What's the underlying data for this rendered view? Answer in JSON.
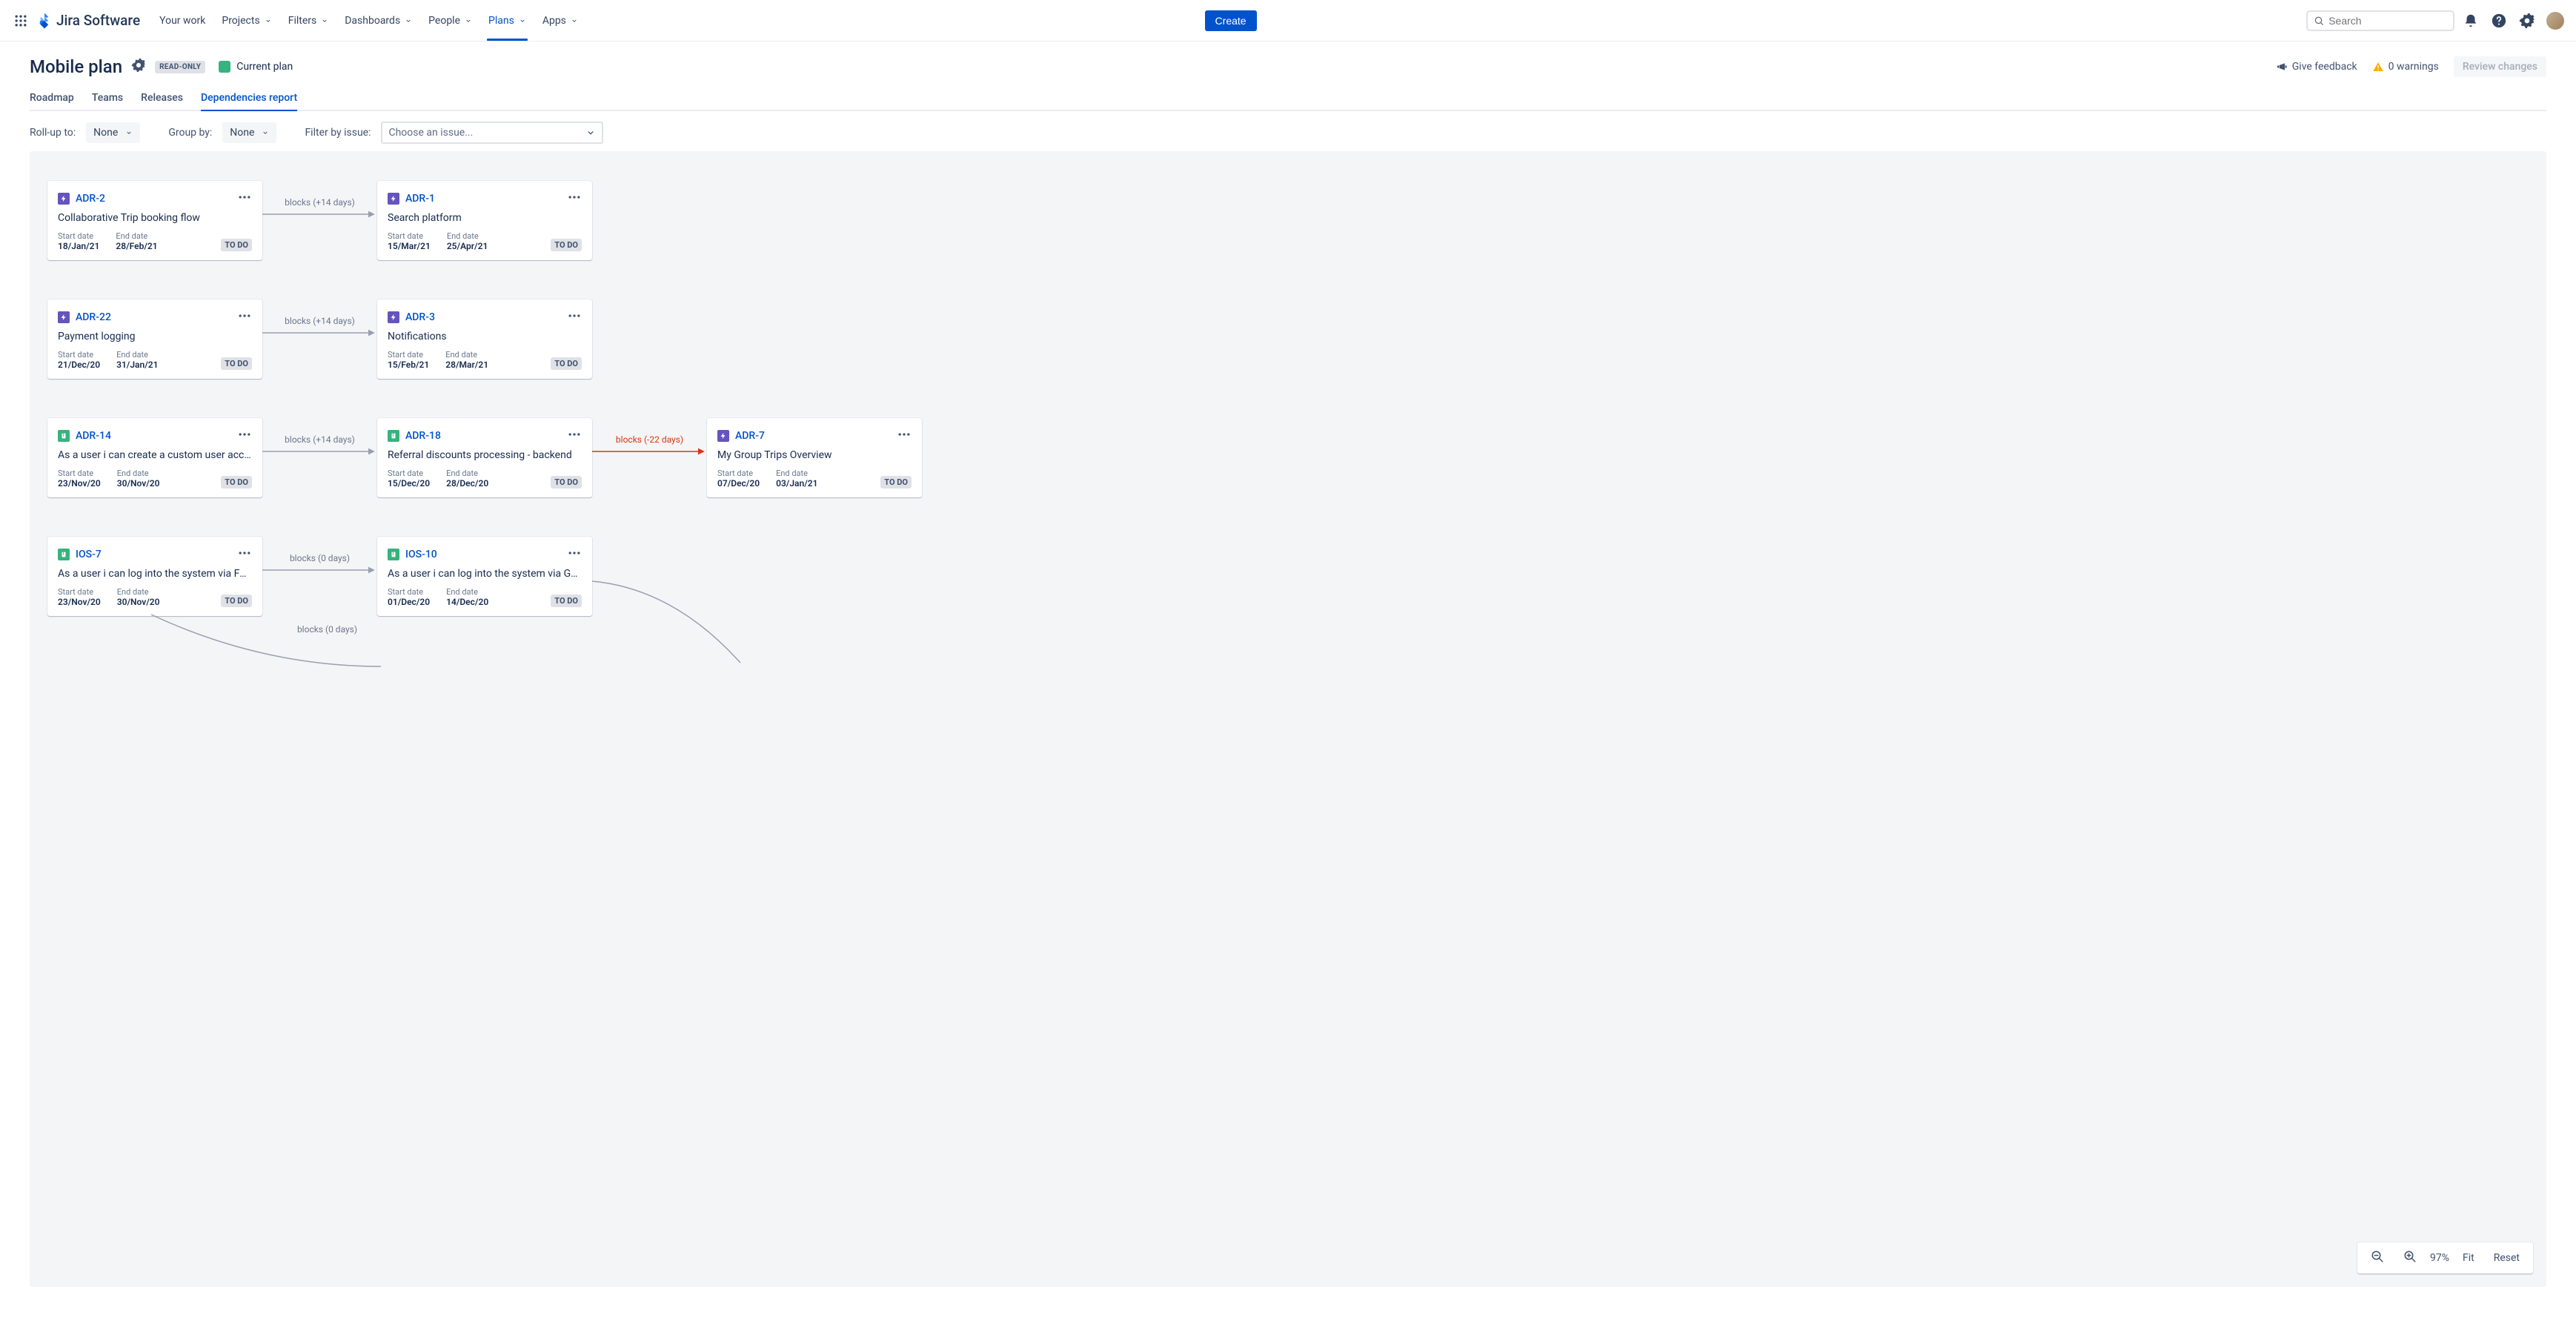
{
  "nav": {
    "logo_text": "Jira Software",
    "items": [
      "Your work",
      "Projects",
      "Filters",
      "Dashboards",
      "People",
      "Plans",
      "Apps"
    ],
    "active_index": 5,
    "create": "Create",
    "search_placeholder": "Search"
  },
  "header": {
    "title": "Mobile plan",
    "readonly_badge": "READ-ONLY",
    "current_plan": "Current plan",
    "give_feedback": "Give feedback",
    "warnings": "0 warnings",
    "review": "Review changes"
  },
  "tabs": {
    "items": [
      "Roadmap",
      "Teams",
      "Releases",
      "Dependencies report"
    ],
    "active_index": 3
  },
  "toolbar": {
    "rollup_label": "Roll-up to:",
    "rollup_value": "None",
    "groupby_label": "Group by:",
    "groupby_value": "None",
    "filter_label": "Filter by issue:",
    "filter_placeholder": "Choose an issue..."
  },
  "labels": {
    "start": "Start date",
    "end": "End date"
  },
  "rows": [
    {
      "conn1": "blocks (+14 days)",
      "cards": [
        {
          "type": "epic",
          "key": "ADR-2",
          "title": "Collaborative Trip booking flow",
          "start": "18/Jan/21",
          "end": "28/Feb/21",
          "status": "TO DO"
        },
        {
          "type": "epic",
          "key": "ADR-1",
          "title": "Search platform",
          "start": "15/Mar/21",
          "end": "25/Apr/21",
          "status": "TO DO"
        }
      ]
    },
    {
      "conn1": "blocks (+14 days)",
      "cards": [
        {
          "type": "epic",
          "key": "ADR-22",
          "title": "Payment logging",
          "start": "21/Dec/20",
          "end": "31/Jan/21",
          "status": "TO DO"
        },
        {
          "type": "epic",
          "key": "ADR-3",
          "title": "Notifications",
          "start": "15/Feb/21",
          "end": "28/Mar/21",
          "status": "TO DO"
        }
      ]
    },
    {
      "conn1": "blocks (+14 days)",
      "conn2": "blocks (-22 days)",
      "cards": [
        {
          "type": "story",
          "key": "ADR-14",
          "title": "As a user i can create a custom user acc…",
          "start": "23/Nov/20",
          "end": "30/Nov/20",
          "status": "TO DO"
        },
        {
          "type": "story",
          "key": "ADR-18",
          "title": "Referral discounts processing - backend",
          "start": "15/Dec/20",
          "end": "28/Dec/20",
          "status": "TO DO"
        },
        {
          "type": "epic",
          "key": "ADR-7",
          "title": "My Group Trips Overview",
          "start": "07/Dec/20",
          "end": "03/Jan/21",
          "status": "TO DO"
        }
      ]
    },
    {
      "conn1": "blocks (0 days)",
      "conn_below": "blocks (0 days)",
      "cards": [
        {
          "type": "story",
          "key": "IOS-7",
          "title": "As a user i can log into the system via Fa…",
          "start": "23/Nov/20",
          "end": "30/Nov/20",
          "status": "TO DO"
        },
        {
          "type": "story",
          "key": "IOS-10",
          "title": "As a user i can log into the system via G…",
          "start": "01/Dec/20",
          "end": "14/Dec/20",
          "status": "TO DO"
        }
      ]
    }
  ],
  "zoom": {
    "value": "97%",
    "fit": "Fit",
    "reset": "Reset"
  }
}
